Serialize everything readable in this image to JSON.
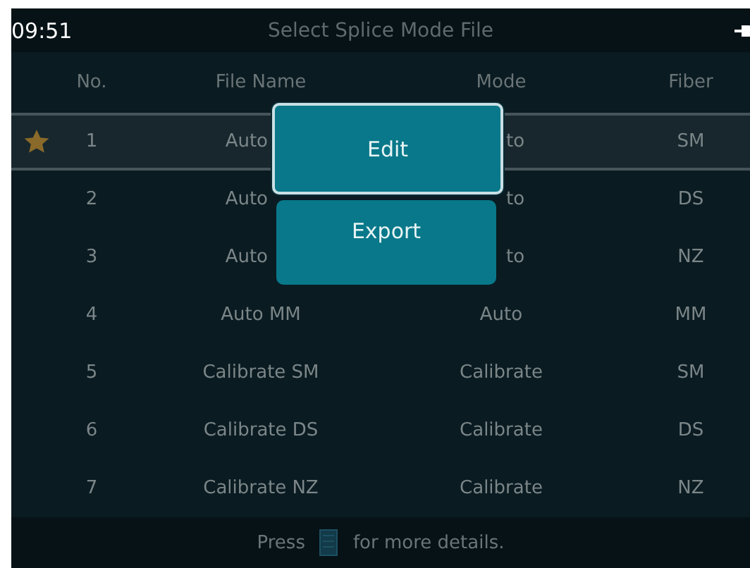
{
  "header": {
    "time": "09:51",
    "title": "Select Splice Mode File"
  },
  "columns": [
    "No.",
    "File Name",
    "Mode",
    "Fiber"
  ],
  "rows": [
    {
      "no": "1",
      "file_name": "Auto",
      "mode": "to",
      "fiber": "SM",
      "selected": true,
      "starred": true,
      "partly_hidden": true
    },
    {
      "no": "2",
      "file_name": "Auto",
      "mode": "to",
      "fiber": "DS",
      "selected": false,
      "starred": false,
      "partly_hidden": true
    },
    {
      "no": "3",
      "file_name": "Auto",
      "mode": "to",
      "fiber": "NZ",
      "selected": false,
      "starred": false,
      "partly_hidden": true
    },
    {
      "no": "4",
      "file_name": "Auto MM",
      "mode": "Auto",
      "fiber": "MM",
      "selected": false,
      "starred": false,
      "partly_hidden": false
    },
    {
      "no": "5",
      "file_name": "Calibrate SM",
      "mode": "Calibrate",
      "fiber": "SM",
      "selected": false,
      "starred": false,
      "partly_hidden": false
    },
    {
      "no": "6",
      "file_name": "Calibrate DS",
      "mode": "Calibrate",
      "fiber": "DS",
      "selected": false,
      "starred": false,
      "partly_hidden": false
    },
    {
      "no": "7",
      "file_name": "Calibrate NZ",
      "mode": "Calibrate",
      "fiber": "NZ",
      "selected": false,
      "starred": false,
      "partly_hidden": false
    }
  ],
  "popup_menu": [
    {
      "label": "Edit",
      "selected": true
    },
    {
      "label": "Export",
      "selected": false
    }
  ],
  "footer": {
    "before": "Press",
    "after": "for more details."
  }
}
